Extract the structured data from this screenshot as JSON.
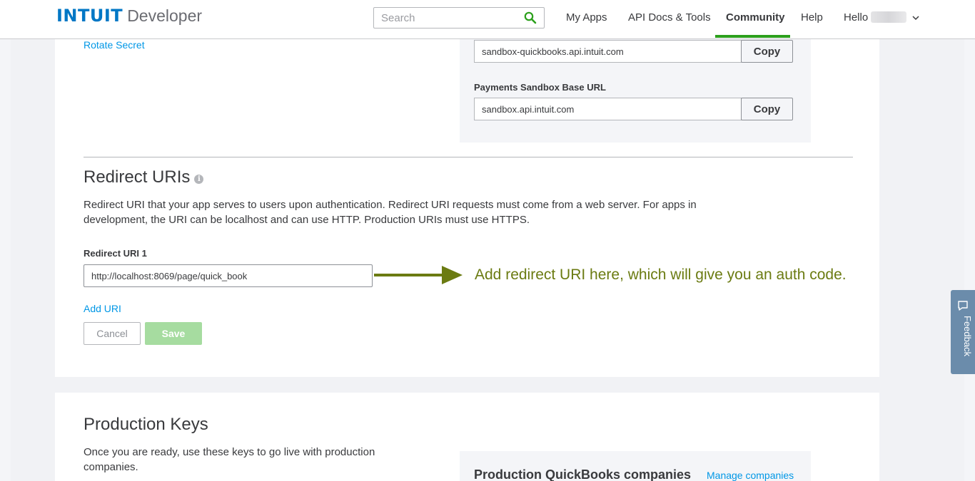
{
  "header": {
    "logo_brand": "INTUIT",
    "logo_product": "Developer",
    "search_placeholder": "Search",
    "nav": {
      "my_apps": "My Apps",
      "api_docs": "API Docs & Tools",
      "community": "Community",
      "help": "Help",
      "hello": "Hello"
    }
  },
  "keys_section": {
    "rotate_secret": "Rotate Secret",
    "accounting_url": "sandbox-quickbooks.api.intuit.com",
    "payments_label": "Payments Sandbox Base URL",
    "payments_url": "sandbox.api.intuit.com",
    "copy_label": "Copy"
  },
  "redirect": {
    "title": "Redirect URIs",
    "info_glyph": "i",
    "description": "Redirect URI that your app serves to users upon authentication. Redirect URI requests must come from a web server. For apps in development, the URI can be localhost and can use HTTP. Production URIs must use HTTPS.",
    "field_label": "Redirect URI 1",
    "field_value": "http://localhost:8069/page/quick_book",
    "add_uri": "Add URI",
    "cancel": "Cancel",
    "save": "Save",
    "annotation": "Add redirect URI here, which will give you an auth code.",
    "annotation_color": "#6b7b12"
  },
  "production": {
    "title": "Production Keys",
    "description": "Once you are ready, use these keys to go live with production companies.",
    "companies_title": "Production QuickBooks companies",
    "manage_link": "Manage companies"
  },
  "feedback": {
    "label": "Feedback"
  },
  "colors": {
    "accent_green": "#2ca01c",
    "link_blue": "#0097e6",
    "brand_blue": "#0077c5"
  }
}
